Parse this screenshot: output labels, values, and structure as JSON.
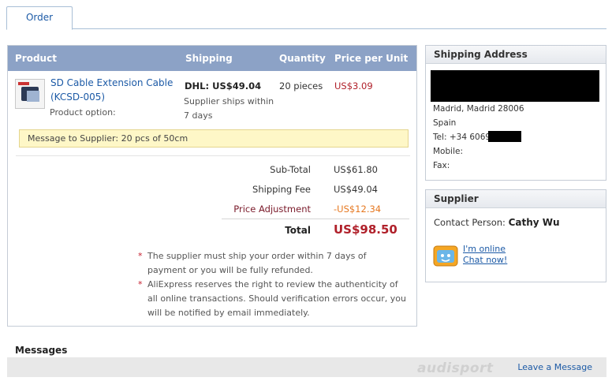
{
  "tabs": [
    {
      "label": "Order"
    }
  ],
  "order": {
    "columns": {
      "product": "Product",
      "shipping": "Shipping",
      "quantity": "Quantity",
      "price": "Price per Unit"
    },
    "item": {
      "name_line1": "SD Cable Extension Cable",
      "name_line2": "(KCSD-005)",
      "option_label": "Product option:",
      "shipping_method": "DHL: US$49.04",
      "shipping_note": "Supplier ships within 7 days",
      "quantity": "20 pieces",
      "price": "US$3.09"
    },
    "message": "Message to Supplier: 20 pcs of 50cm",
    "summary": {
      "subtotal_label": "Sub-Total",
      "subtotal": "US$61.80",
      "shipping_label": "Shipping Fee",
      "shipping": "US$49.04",
      "adjust_label": "Price Adjustment",
      "adjust": "-US$12.34",
      "total_label": "Total",
      "total": "US$98.50"
    },
    "notes": [
      "The supplier must ship your order within 7 days of payment or you will be fully refunded.",
      "AliExpress reserves the right to review the authenticity of all online transactions. Should verification errors occur, you will be notified by email immediately."
    ]
  },
  "shipping_address": {
    "title": "Shipping Address",
    "city": "Madrid, Madrid 28006",
    "country": "Spain",
    "tel": "Tel: +34 6069",
    "mobile": "Mobile:",
    "fax": "Fax:"
  },
  "supplier": {
    "title": "Supplier",
    "contact_label": "Contact Person:",
    "contact_name": "Cathy Wu",
    "online_line1": "I'm online",
    "online_line2": "Chat now!"
  },
  "messages": {
    "title": "Messages",
    "leave_label": "Leave a Message"
  },
  "watermark": "audisport",
  "colors": {
    "header": "#8ca2c6",
    "link": "#1c5aa6",
    "price": "#b0202a",
    "adjust": "#e67820"
  }
}
